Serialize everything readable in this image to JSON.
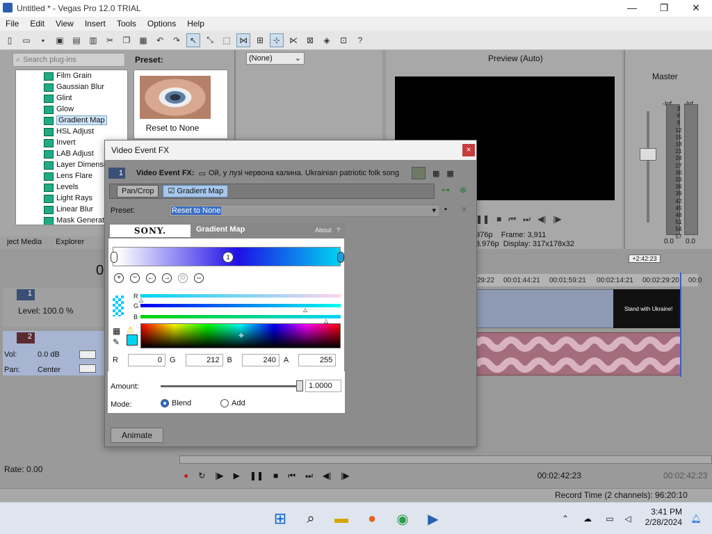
{
  "window": {
    "title": "Untitled * - Vegas Pro 12.0 TRIAL",
    "min_icon": "minimize-icon",
    "max_icon": "maximize-icon",
    "close_icon": "close-icon"
  },
  "menu": [
    "File",
    "Edit",
    "View",
    "Insert",
    "Tools",
    "Options",
    "Help"
  ],
  "plugins": {
    "search_placeholder": "Search plug-ins",
    "items": [
      "Film Grain",
      "Gaussian Blur",
      "Glint",
      "Glow",
      "Gradient Map",
      "HSL Adjust",
      "Invert",
      "LAB Adjust",
      "Layer Dimensio",
      "Lens Flare",
      "Levels",
      "Light Rays",
      "Linear Blur",
      "Mask Generato"
    ],
    "selected": "Gradient Map",
    "preset_label": "Preset:",
    "preset_card": "Reset to None",
    "tabs": [
      "ject Media",
      "Explorer"
    ]
  },
  "mid": {
    "select_value": "(None)"
  },
  "preview": {
    "mode": "Preview (Auto)",
    "frame_label": "Frame:",
    "frame_value": "3,911",
    "display_label": "Display:",
    "display_value": "317x178x32",
    "tc1": "976p",
    "tc2": "3.976p"
  },
  "master": {
    "label": "Master",
    "inf_left": "-Inf.",
    "inf_right": "-Inf.",
    "scale": [
      "3",
      "6",
      "9",
      "12",
      "15",
      "18",
      "21",
      "24",
      "27",
      "30",
      "33",
      "36",
      "39",
      "42",
      "45",
      "48",
      "51",
      "54",
      "57"
    ],
    "db_left": "0.0",
    "db_right": "0.0"
  },
  "timeline": {
    "ruler": [
      "29:22",
      "00:01:44:21",
      "00:01:59:21",
      "00:02:14:21",
      "00:02:29:20",
      "00:0"
    ],
    "end_marker": "+2:42:23",
    "track1": {
      "num": "1",
      "level": "Level: 100.0 %"
    },
    "track2": {
      "num": "2",
      "vol_label": "Vol:",
      "vol_value": "0.0 dB",
      "pan_label": "Pan:",
      "pan_value": "Center"
    },
    "clip_text": "Stand with Ukraine!",
    "time_left": "0"
  },
  "bottom": {
    "rate": "Rate: 0.00",
    "tc_current": "00:02:42:23",
    "tc_end": "00:02:42:23",
    "record_time": "Record Time (2 channels): 96:20:10"
  },
  "taskbar": {
    "time": "3:41 PM",
    "date": "2/28/2024"
  },
  "dialog": {
    "title": "Video Event FX",
    "close": "×",
    "fx_label": "Video Event FX:",
    "fx_title": "Ой, у лузі червона калина. Ukrainian patriotic folk song",
    "chain_num": "1",
    "chain": [
      "Pan/Crop",
      "Gradient Map"
    ],
    "preset_label": "Preset:",
    "preset_value": "Reset to None",
    "animate": "Animate"
  },
  "gradient_map": {
    "brand": "SONY.",
    "name": "Gradient Map",
    "about": "About",
    "help": "?",
    "handle": "1",
    "channels": [
      "R",
      "G",
      "B"
    ],
    "r_label": "R",
    "r": "0",
    "g_label": "G",
    "g": "212",
    "b_label": "B",
    "b": "240",
    "a_label": "A",
    "a": "255",
    "amount_label": "Amount:",
    "amount": "1.0000",
    "amount_fraction": 1.0,
    "mode_label": "Mode:",
    "mode_blend": "Blend",
    "mode_add": "Add",
    "mode_selected": "Blend",
    "colors": {
      "start": "#ffffff",
      "mid": "#1e10e6",
      "end": "#00d4f0"
    }
  }
}
